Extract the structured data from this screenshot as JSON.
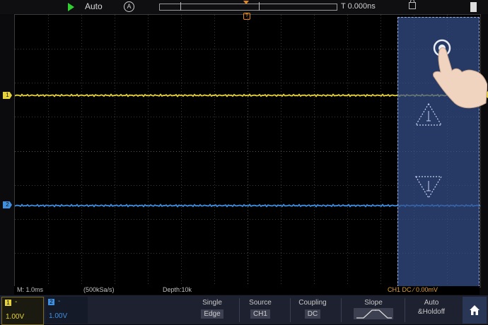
{
  "top_bar": {
    "trigger_mode": "Auto",
    "auto_badge": "A",
    "trigger_time": "T 0.000ns"
  },
  "waveform": {
    "ch1_marker": "1",
    "ch2_marker": "2",
    "trigger_marker": "T"
  },
  "status_row": {
    "timebase": "M: 1.0ms",
    "sample_rate": "(500kSa/s)",
    "depth": "Depth:10k",
    "trigger_status": "CH1 DC  ∕  0.00mV"
  },
  "channels": {
    "ch1": {
      "badge": "1",
      "coupling": "-",
      "scale": "1.00V",
      "color": "#e6d23a"
    },
    "ch2": {
      "badge": "2",
      "coupling": "-",
      "scale": "1.00V",
      "color": "#3f8fe0"
    }
  },
  "softkeys": {
    "type": {
      "top": "Single",
      "value": "Edge"
    },
    "source": {
      "top": "Source",
      "value": "CH1"
    },
    "coupling": {
      "top": "Coupling",
      "value": "DC"
    },
    "slope": {
      "top": "Slope"
    },
    "holdoff": {
      "top": "Auto",
      "value": "&Holdoff"
    }
  },
  "icons": [
    "run-arrow-icon",
    "lock-icon",
    "battery-icon",
    "arrow-up-icon",
    "arrow-down-icon",
    "hand-pointer-icon",
    "home-icon"
  ]
}
